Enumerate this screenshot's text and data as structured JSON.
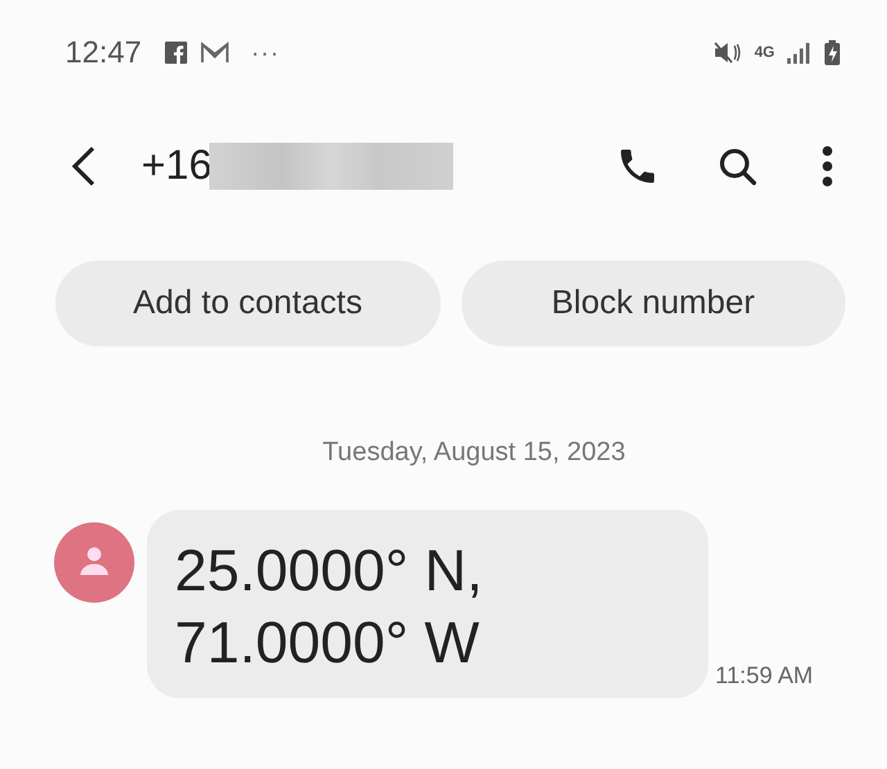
{
  "status_bar": {
    "time": "12:47",
    "more": "···",
    "network": "4G"
  },
  "header": {
    "title": "+16",
    "redacted": true
  },
  "actions": [
    {
      "label": "Add to contacts"
    },
    {
      "label": "Block number"
    }
  ],
  "date": "Tuesday, August 15, 2023",
  "message": {
    "text": "25.0000° N, 71.0000° W",
    "time": "11:59 AM"
  }
}
